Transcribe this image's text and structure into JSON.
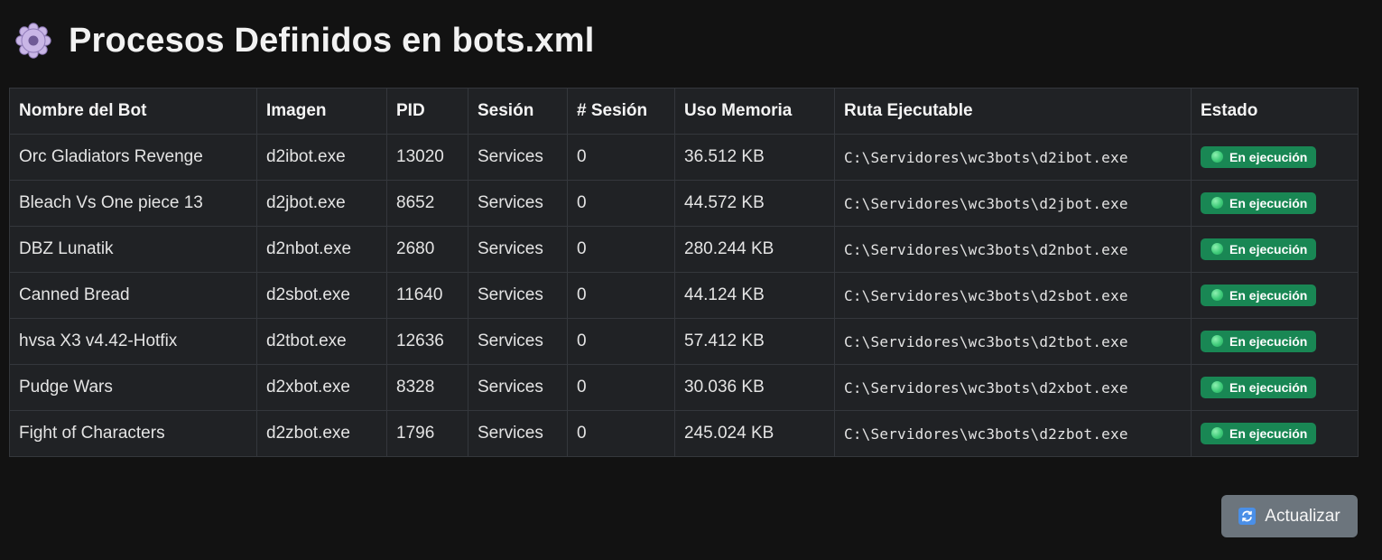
{
  "page": {
    "title": "Procesos Definidos en bots.xml",
    "title_icon": "gear-icon"
  },
  "table": {
    "headers": [
      "Nombre del Bot",
      "Imagen",
      "PID",
      "Sesión",
      "# Sesión",
      "Uso Memoria",
      "Ruta Ejecutable",
      "Estado"
    ],
    "rows": [
      {
        "name": "Orc Gladiators Revenge",
        "image": "d2ibot.exe",
        "pid": "13020",
        "session": "Services",
        "session_num": "0",
        "memory": "36.512 KB",
        "path": "C:\\Servidores\\wc3bots\\d2ibot.exe",
        "status": "En ejecución"
      },
      {
        "name": "Bleach Vs One piece 13",
        "image": "d2jbot.exe",
        "pid": "8652",
        "session": "Services",
        "session_num": "0",
        "memory": "44.572 KB",
        "path": "C:\\Servidores\\wc3bots\\d2jbot.exe",
        "status": "En ejecución"
      },
      {
        "name": "DBZ Lunatik",
        "image": "d2nbot.exe",
        "pid": "2680",
        "session": "Services",
        "session_num": "0",
        "memory": "280.244 KB",
        "path": "C:\\Servidores\\wc3bots\\d2nbot.exe",
        "status": "En ejecución"
      },
      {
        "name": "Canned Bread",
        "image": "d2sbot.exe",
        "pid": "11640",
        "session": "Services",
        "session_num": "0",
        "memory": "44.124 KB",
        "path": "C:\\Servidores\\wc3bots\\d2sbot.exe",
        "status": "En ejecución"
      },
      {
        "name": "hvsa X3 v4.42-Hotfix",
        "image": "d2tbot.exe",
        "pid": "12636",
        "session": "Services",
        "session_num": "0",
        "memory": "57.412 KB",
        "path": "C:\\Servidores\\wc3bots\\d2tbot.exe",
        "status": "En ejecución"
      },
      {
        "name": "Pudge Wars",
        "image": "d2xbot.exe",
        "pid": "8328",
        "session": "Services",
        "session_num": "0",
        "memory": "30.036 KB",
        "path": "C:\\Servidores\\wc3bots\\d2xbot.exe",
        "status": "En ejecución"
      },
      {
        "name": "Fight of Characters",
        "image": "d2zbot.exe",
        "pid": "1796",
        "session": "Services",
        "session_num": "0",
        "memory": "245.024 KB",
        "path": "C:\\Servidores\\wc3bots\\d2zbot.exe",
        "status": "En ejecución"
      }
    ]
  },
  "refresh_button": {
    "label": "Actualizar",
    "icon": "refresh-icon"
  },
  "colors": {
    "background": "#121212",
    "table_bg": "#202225",
    "status_badge": "#198754",
    "button_bg": "#6c757d"
  }
}
